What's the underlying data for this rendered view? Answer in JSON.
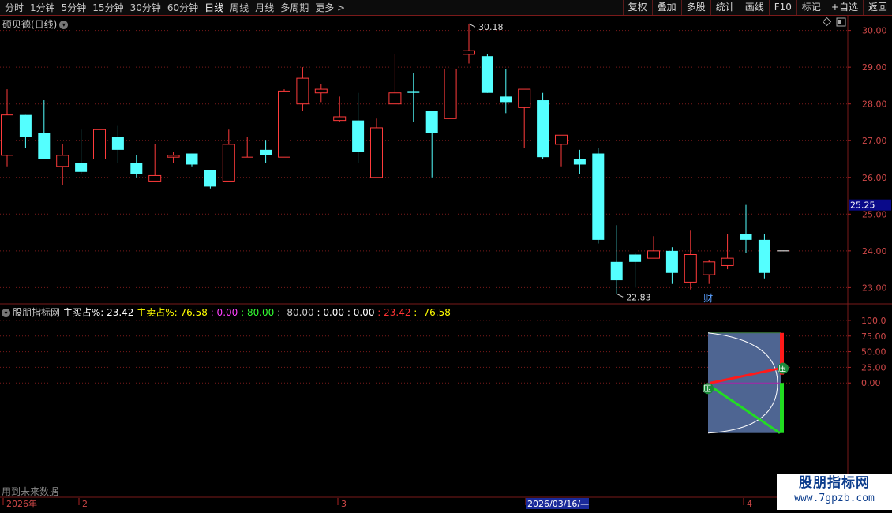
{
  "toolbar": {
    "periods": [
      "分时",
      "1分钟",
      "5分钟",
      "15分钟",
      "30分钟",
      "60分钟",
      "日线",
      "周线",
      "月线",
      "多周期",
      "更多 >"
    ],
    "active_period": "日线",
    "right_buttons": [
      "复权",
      "叠加",
      "多股",
      "统计",
      "画线",
      "F10",
      "标记",
      "+自选",
      "返回"
    ]
  },
  "stock_title": "硕贝德(日线)",
  "chart_data": [
    {
      "type": "candlestick",
      "title": "硕贝德(日线)",
      "ylim": [
        22.6,
        30.4
      ],
      "y_ticks": [
        "30.00",
        "29.00",
        "28.00",
        "27.00",
        "26.00",
        "25.00",
        "24.00",
        "23.00"
      ],
      "current_price_label": "25.25",
      "candles": [
        {
          "o": 26.6,
          "c": 27.7,
          "h": 28.4,
          "l": 26.3
        },
        {
          "o": 27.7,
          "c": 27.1,
          "h": 27.7,
          "l": 26.8
        },
        {
          "o": 27.2,
          "c": 26.5,
          "h": 28.1,
          "l": 26.5
        },
        {
          "o": 26.3,
          "c": 26.6,
          "h": 26.9,
          "l": 25.8
        },
        {
          "o": 26.4,
          "c": 26.15,
          "h": 27.3,
          "l": 26.1
        },
        {
          "o": 26.5,
          "c": 27.3,
          "h": 27.3,
          "l": 26.5
        },
        {
          "o": 27.1,
          "c": 26.75,
          "h": 27.4,
          "l": 26.4
        },
        {
          "o": 26.4,
          "c": 26.1,
          "h": 26.6,
          "l": 26.0
        },
        {
          "o": 25.9,
          "c": 26.05,
          "h": 26.9,
          "l": 25.9
        },
        {
          "o": 26.55,
          "c": 26.6,
          "h": 26.7,
          "l": 26.4
        },
        {
          "o": 26.65,
          "c": 26.35,
          "h": 26.65,
          "l": 26.3
        },
        {
          "o": 26.2,
          "c": 25.75,
          "h": 26.2,
          "l": 25.7
        },
        {
          "o": 25.9,
          "c": 26.9,
          "h": 27.3,
          "l": 25.9
        },
        {
          "o": 26.55,
          "c": 26.55,
          "h": 27.1,
          "l": 26.55
        },
        {
          "o": 26.75,
          "c": 26.6,
          "h": 27.0,
          "l": 26.4
        },
        {
          "o": 26.55,
          "c": 28.35,
          "h": 28.4,
          "l": 26.55
        },
        {
          "o": 28.0,
          "c": 28.7,
          "h": 29.0,
          "l": 27.8
        },
        {
          "o": 28.3,
          "c": 28.4,
          "h": 28.55,
          "l": 28.05
        },
        {
          "o": 27.55,
          "c": 27.65,
          "h": 28.2,
          "l": 27.5
        },
        {
          "o": 27.55,
          "c": 26.7,
          "h": 28.3,
          "l": 26.4
        },
        {
          "o": 26.0,
          "c": 27.35,
          "h": 27.6,
          "l": 26.0
        },
        {
          "o": 28.0,
          "c": 28.3,
          "h": 29.35,
          "l": 28.0
        },
        {
          "o": 28.35,
          "c": 28.3,
          "h": 28.85,
          "l": 27.5
        },
        {
          "o": 27.8,
          "c": 27.2,
          "h": 27.8,
          "l": 26.0
        },
        {
          "o": 27.6,
          "c": 28.95,
          "h": 28.95,
          "l": 27.6
        },
        {
          "o": 29.35,
          "c": 29.45,
          "h": 30.18,
          "l": 29.1
        },
        {
          "o": 29.3,
          "c": 28.3,
          "h": 29.35,
          "l": 28.3
        },
        {
          "o": 28.2,
          "c": 28.05,
          "h": 28.95,
          "l": 27.75
        },
        {
          "o": 27.9,
          "c": 28.4,
          "h": 28.4,
          "l": 26.8
        },
        {
          "o": 28.1,
          "c": 26.55,
          "h": 28.3,
          "l": 26.5
        },
        {
          "o": 26.9,
          "c": 27.15,
          "h": 27.15,
          "l": 26.3
        },
        {
          "o": 26.5,
          "c": 26.35,
          "h": 26.75,
          "l": 26.1
        },
        {
          "o": 26.65,
          "c": 24.3,
          "h": 26.8,
          "l": 24.2
        },
        {
          "o": 23.7,
          "c": 23.2,
          "h": 24.7,
          "l": 22.83
        },
        {
          "o": 23.9,
          "c": 23.7,
          "h": 23.95,
          "l": 23.0
        },
        {
          "o": 23.8,
          "c": 24.0,
          "h": 24.4,
          "l": 23.8
        },
        {
          "o": 24.0,
          "c": 23.4,
          "h": 24.1,
          "l": 23.1
        },
        {
          "o": 23.15,
          "c": 23.9,
          "h": 24.55,
          "l": 22.95
        },
        {
          "o": 23.35,
          "c": 23.7,
          "h": 23.75,
          "l": 23.1
        },
        {
          "o": 23.6,
          "c": 23.8,
          "h": 24.45,
          "l": 23.5
        },
        {
          "o": 24.45,
          "c": 24.3,
          "h": 25.25,
          "l": 23.95
        },
        {
          "o": 24.3,
          "c": 23.4,
          "h": 24.45,
          "l": 23.25
        },
        {
          "o": 24.0,
          "c": 24.0,
          "h": 24.0,
          "l": 24.0
        }
      ],
      "annotations": {
        "high_label": "30.18",
        "low_label": "22.83",
        "finance_mark": "财"
      }
    },
    {
      "type": "indicator",
      "title": "股朋指标网",
      "ylim": [
        -180,
        110
      ],
      "y_ticks": [
        "100.0",
        "75.00",
        "50.00",
        "25.00",
        "0.00"
      ],
      "series": [
        {
          "label": "主买占%:",
          "value": "23.42",
          "color": "#ffffff"
        },
        {
          "label": "主卖占%:",
          "value": "76.58",
          "color": "#ffff00"
        },
        {
          "value": "0.00",
          "color": "#ff40ff"
        },
        {
          "value": "80.00",
          "color": "#33ff33"
        },
        {
          "value": "-80.00",
          "color": "#cccccc"
        },
        {
          "value": "0.00",
          "color": "#ffffff"
        },
        {
          "value": "0.00",
          "color": "#ffffff"
        },
        {
          "value": "23.42",
          "color": "#ff3333"
        },
        {
          "value": "-76.58",
          "color": "#ffff00"
        }
      ],
      "buy_pct": 23.42,
      "sell_pct": -76.58,
      "box_top": 80,
      "box_bottom": -80,
      "marks": [
        "压",
        "压"
      ]
    }
  ],
  "x_axis": {
    "labels": [
      "2026年",
      "2",
      "3",
      "2026/03/16/—",
      "4"
    ]
  },
  "future_note": "用到未来数据",
  "watermark": {
    "line1": "股朋指标网",
    "line2": "www.7gpzb.com"
  },
  "colors": {
    "up": "#ff3b3b",
    "down": "#54ffff",
    "grid": "#7a1a1a"
  }
}
